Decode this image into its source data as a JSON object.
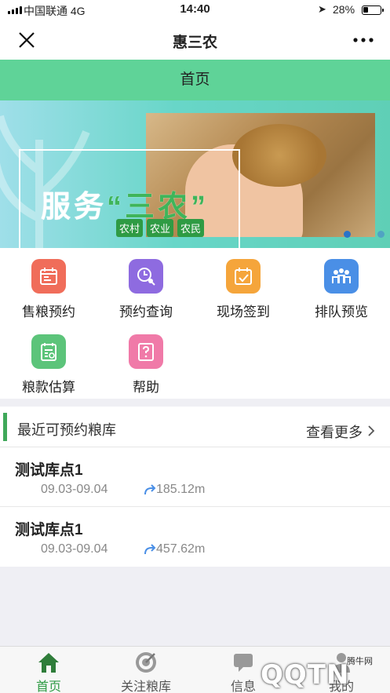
{
  "status_bar": {
    "carrier": "中国联通",
    "network": "4G",
    "time": "14:40",
    "battery": "28%"
  },
  "nav": {
    "title": "惠三农",
    "close_icon": "close-icon",
    "more_icon": "more-dots-icon"
  },
  "page_header": "首页",
  "banner": {
    "headline_a": "服务",
    "headline_b": "“三农”",
    "tags": [
      "农村",
      "农业",
      "农民"
    ],
    "slide_index": 1,
    "slide_count": 2
  },
  "features": [
    {
      "label": "售粮预约",
      "icon": "calendar-icon",
      "color": "#f06d5a"
    },
    {
      "label": "预约查询",
      "icon": "clock-search-icon",
      "color": "#8e6be0"
    },
    {
      "label": "现场签到",
      "icon": "checkin-icon",
      "color": "#f5a53b"
    },
    {
      "label": "排队预览",
      "icon": "people-queue-icon",
      "color": "#4a8fe6"
    },
    {
      "label": "粮款估算",
      "icon": "calculator-icon",
      "color": "#5cc47a"
    },
    {
      "label": "帮助",
      "icon": "help-icon",
      "color": "#f07aa8"
    }
  ],
  "recent": {
    "title": "最近可预约粮库",
    "more": "查看更多",
    "items": [
      {
        "name": "测试库点1",
        "dates": "09.03-09.04",
        "distance": "185.12m"
      },
      {
        "name": "测试库点1",
        "dates": "09.03-09.04",
        "distance": "457.62m"
      }
    ]
  },
  "tabs": [
    {
      "label": "首页",
      "icon": "home-icon"
    },
    {
      "label": "关注粮库",
      "icon": "target-icon"
    },
    {
      "label": "信息",
      "icon": "message-icon"
    },
    {
      "label": "我的",
      "icon": "user-icon"
    }
  ],
  "watermark": {
    "text": "QQTN",
    "small": "腾牛网"
  }
}
